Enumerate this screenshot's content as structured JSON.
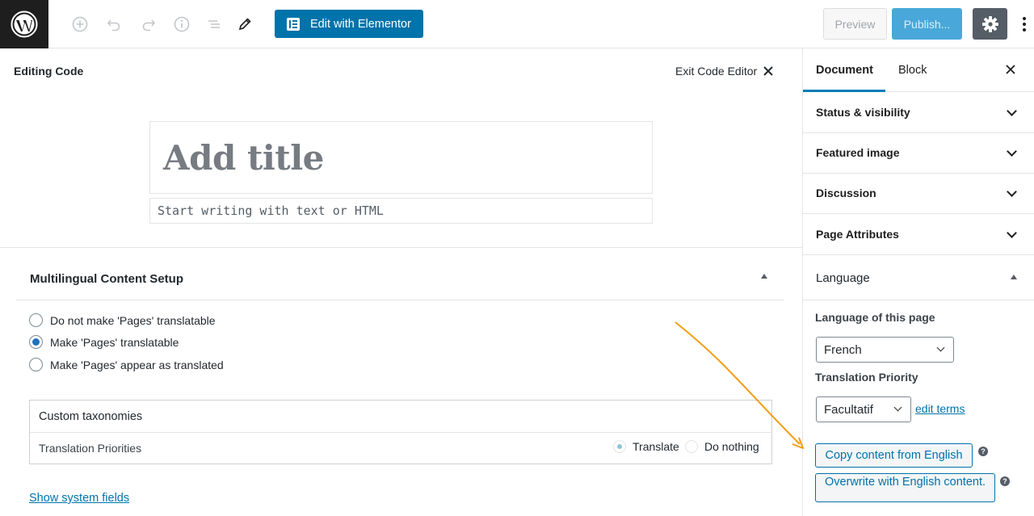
{
  "toolbar": {
    "elementor_label": "Edit with Elementor",
    "preview_label": "Preview",
    "publish_label": "Publish..."
  },
  "editor": {
    "editing_code_label": "Editing Code",
    "exit_code_editor_label": "Exit Code Editor",
    "title_placeholder": "Add title",
    "content_placeholder": "Start writing with text or HTML"
  },
  "multilingual": {
    "title": "Multilingual Content Setup",
    "options": [
      {
        "label": "Do not make 'Pages' translatable",
        "checked": false
      },
      {
        "label": "Make 'Pages' translatable",
        "checked": true
      },
      {
        "label": "Make 'Pages' appear as translated",
        "checked": false
      }
    ],
    "taxonomies_header": "Custom taxonomies",
    "translation_priorities_label": "Translation Priorities",
    "translate_label": "Translate",
    "do_nothing_label": "Do nothing",
    "system_fields_link": "Show system fields"
  },
  "sidebar": {
    "tabs": [
      {
        "label": "Document"
      },
      {
        "label": "Block"
      }
    ],
    "panels": [
      {
        "label": "Status & visibility"
      },
      {
        "label": "Featured image"
      },
      {
        "label": "Discussion"
      },
      {
        "label": "Page Attributes"
      }
    ],
    "language_panel": {
      "title": "Language",
      "language_label": "Language of this page",
      "language_value": "French",
      "priority_label": "Translation Priority",
      "priority_value": "Facultatif",
      "edit_terms_link": "edit terms",
      "copy_button": "Copy content from English",
      "overwrite_button": "Overwrite with English content."
    }
  },
  "colors": {
    "accent": "#0073aa",
    "annotation_arrow": "#f39c12"
  }
}
